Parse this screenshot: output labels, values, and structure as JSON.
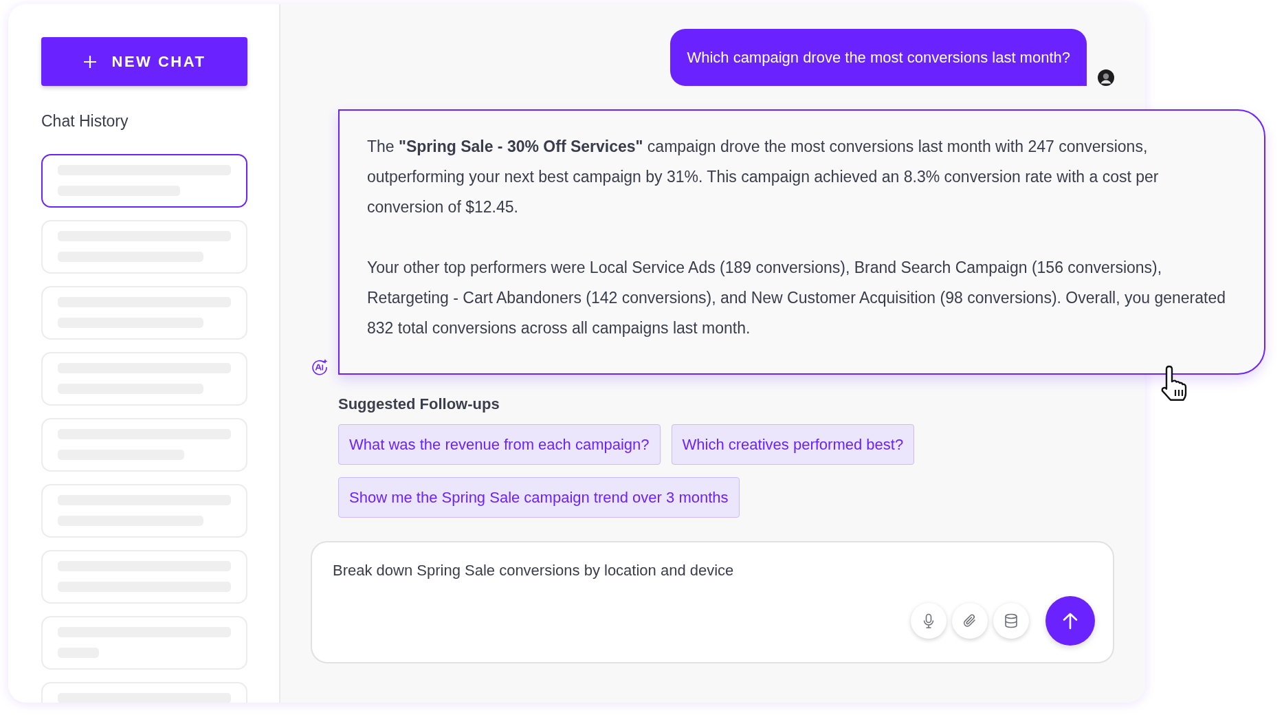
{
  "sidebar": {
    "new_chat_button": "NEW CHAT",
    "history_title": "Chat History",
    "history_items": [
      {
        "selected": true
      },
      {
        "selected": false
      },
      {
        "selected": false
      },
      {
        "selected": false
      },
      {
        "selected": false
      },
      {
        "selected": false
      },
      {
        "selected": false
      },
      {
        "selected": false
      },
      {
        "selected": false
      }
    ]
  },
  "conversation": {
    "user_message": "Which campaign drove the most conversions last month?",
    "assistant_message": [
      "The **\"Spring Sale - 30% Off Services\"** campaign drove the most conversions last month with 247 conversions, outperforming your next best campaign by 31%. This campaign achieved an 8.3% conversion rate with a cost per conversion of $12.45.",
      "Your other top performers were Local Service Ads (189 conversions), Brand Search Campaign (156 conversions), Retargeting - Cart Abandoners (142 conversions), and New Customer Acquisition (98 conversions). Overall, you generated 832 total conversions across all campaigns last month."
    ]
  },
  "suggested_followups": {
    "title": "Suggested Follow-ups",
    "items": [
      "What was the revenue from each campaign?",
      "Which creatives performed best?",
      "Show me the Spring Sale campaign trend over 3 months"
    ]
  },
  "composer": {
    "value": "Break down Spring Sale conversions by location and device"
  }
}
